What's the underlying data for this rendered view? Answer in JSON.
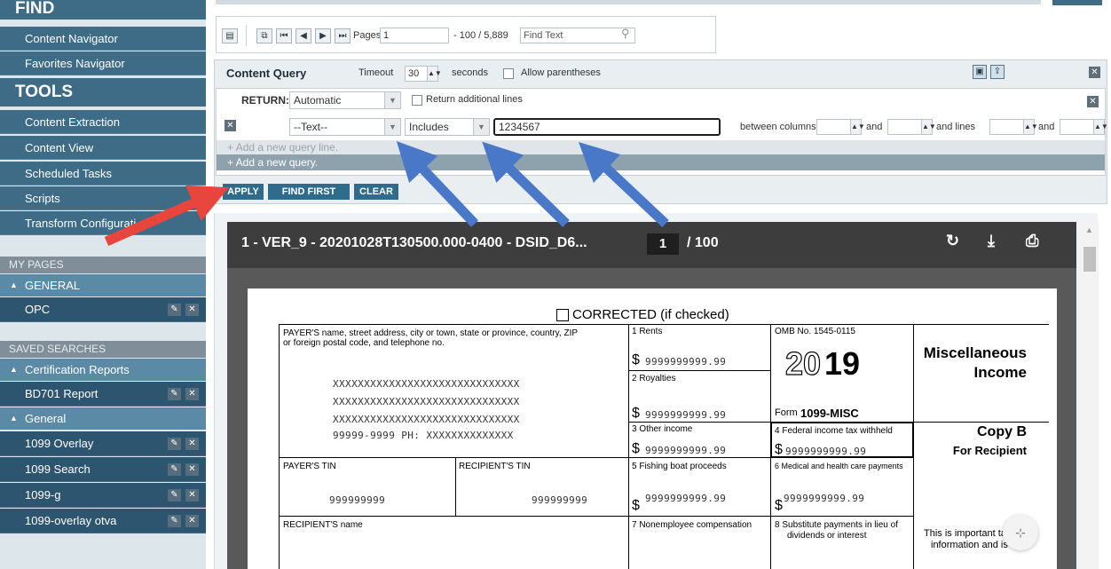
{
  "sidebar": {
    "find_heading": "FIND",
    "find_items": [
      {
        "label": "Content Navigator"
      },
      {
        "label": "Favorites Navigator"
      }
    ],
    "tools_heading": "TOOLS",
    "tools_items": [
      {
        "label": "Content Extraction"
      },
      {
        "label": "Content View"
      },
      {
        "label": "Scheduled Tasks"
      },
      {
        "label": "Scripts"
      },
      {
        "label": "Transform Configurati"
      }
    ],
    "my_pages_heading": "MY PAGES",
    "my_pages_group": "GENERAL",
    "my_pages_items": [
      {
        "label": "OPC"
      }
    ],
    "saved_searches_heading": "SAVED SEARCHES",
    "saved_group_1": "Certification Reports",
    "saved_group_1_items": [
      {
        "label": "BD701 Report"
      }
    ],
    "saved_group_2": "General",
    "saved_group_2_items": [
      {
        "label": "1099 Overlay"
      },
      {
        "label": "1099 Search"
      },
      {
        "label": "1099-g"
      },
      {
        "label": "1099-overlay otva"
      }
    ]
  },
  "toolbar": {
    "pages_label": "Pages",
    "page_value": "1",
    "page_total": "- 100 / 5,889",
    "find_placeholder": "Find Text"
  },
  "query": {
    "title": "Content Query",
    "timeout_label": "Timeout",
    "timeout_value": "30",
    "seconds_label": "seconds",
    "allow_parens_label": "Allow parentheses",
    "return_label": "RETURN:",
    "return_value": "Automatic",
    "return_additional_label": "Return additional lines",
    "field_value": "--Text--",
    "operator_value": "Includes",
    "search_value": "1234567",
    "between_columns_label": "between columns",
    "and_label": "and",
    "and_lines_label": "and lines",
    "add_line_label": "Add a new query line.",
    "add_query_label": "+ Add a new query.",
    "apply_label": "APPLY",
    "find_first_label": "FIND FIRST",
    "clear_label": "CLEAR"
  },
  "viewer": {
    "doc_title": "1 - VER_9 - 20201028T130500.000-0400 - DSID_D6...",
    "page_value": "1",
    "page_total": "/ 100"
  },
  "form": {
    "corrected": "CORRECTED (if checked)",
    "payer_label_1": "PAYER'S name, street address, city or town, state or province, country, ZIP",
    "payer_label_2": "or foreign postal code, and telephone no.",
    "payer_line": "XXXXXXXXXXXXXXXXXXXXXXXXXXXXXX",
    "payer_zip": "99999-9999  PH: XXXXXXXXXXXXXX",
    "rents_label": "1 Rents",
    "rents_value": "9999999999.99",
    "royalties_label": "2 Royalties",
    "royalties_value": "9999999999.99",
    "other_income_label": "3 Other income",
    "other_income_value": "9999999999.99",
    "omb": "OMB No. 1545-0115",
    "year_a": "20",
    "year_b": "19",
    "form_label": "Form",
    "form_name": "1099-MISC",
    "misc_title_1": "Miscellaneous",
    "misc_title_2": "Income",
    "fed_tax_label": "4 Federal income tax withheld",
    "fed_tax_value": "9999999999.99",
    "copy_b": "Copy B",
    "for_recipient": "For Recipient",
    "payer_tin_label": "PAYER'S TIN",
    "payer_tin_value": "999999999",
    "recipient_tin_label": "RECIPIENT'S TIN",
    "recipient_tin_value": "999999999",
    "fishing_label": "5 Fishing boat proceeds",
    "fishing_value": "9999999999.99",
    "medical_label": "6 Medical and health care payments",
    "medical_value": "9999999999.99",
    "recipient_name_label": "RECIPIENT'S name",
    "nonemployee_label": "7 Nonemployee compensation",
    "substitute_label_1": "8 Substitute payments in lieu of",
    "substitute_label_2": "dividends or interest",
    "important_1": "This is important tax",
    "important_2": "information and is",
    "dollar": "$"
  },
  "colors": {
    "sidebar_item": "#3e6b86",
    "sidebar_page": "#2d5570",
    "accent_button": "#2f6b8a",
    "arrow_blue": "#4a78c9",
    "arrow_red": "#e8453c"
  }
}
